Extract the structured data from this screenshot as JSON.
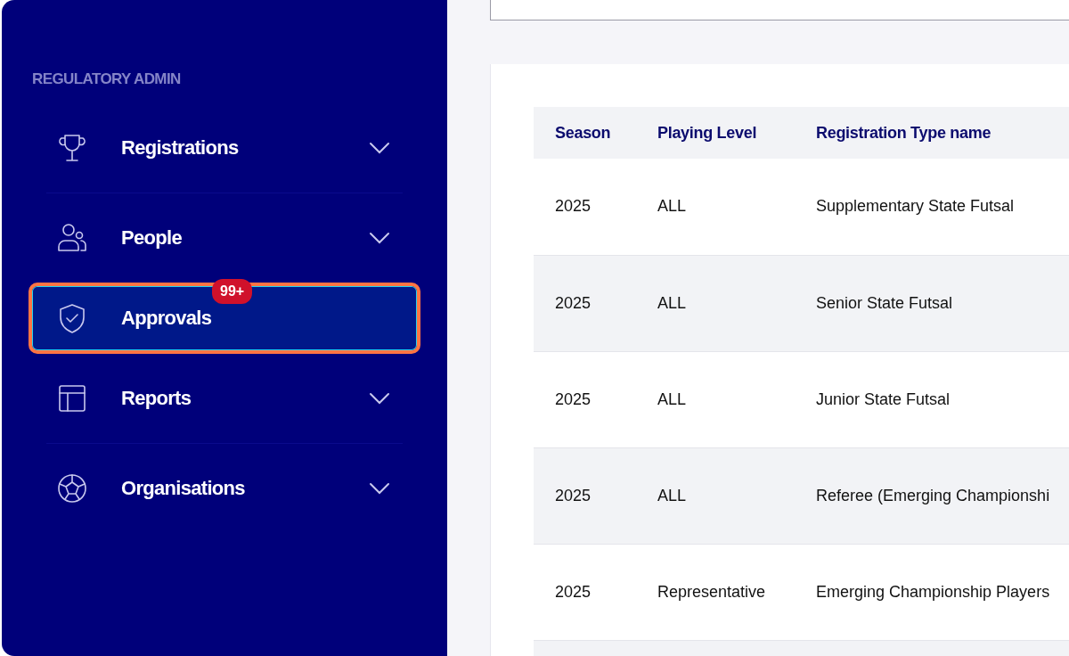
{
  "sidebar": {
    "section_title": "REGULATORY ADMIN",
    "items": [
      {
        "label": "Registrations",
        "expandable": true,
        "selected": false
      },
      {
        "label": "People",
        "expandable": true,
        "selected": false
      },
      {
        "label": "Approvals",
        "expandable": false,
        "selected": true,
        "badge": "99+"
      },
      {
        "label": "Reports",
        "expandable": true,
        "selected": false
      },
      {
        "label": "Organisations",
        "expandable": true,
        "selected": false
      }
    ]
  },
  "table": {
    "columns": [
      "Season",
      "Playing Level",
      "Registration Type name"
    ],
    "rows": [
      [
        "2025",
        "ALL",
        "Supplementary State Futsal"
      ],
      [
        "2025",
        "ALL",
        "Senior State Futsal"
      ],
      [
        "2025",
        "ALL",
        "Junior State Futsal"
      ],
      [
        "2025",
        "ALL",
        "Referee (Emerging Championshi"
      ],
      [
        "2025",
        "Representative",
        "Emerging Championship Players"
      ]
    ]
  }
}
